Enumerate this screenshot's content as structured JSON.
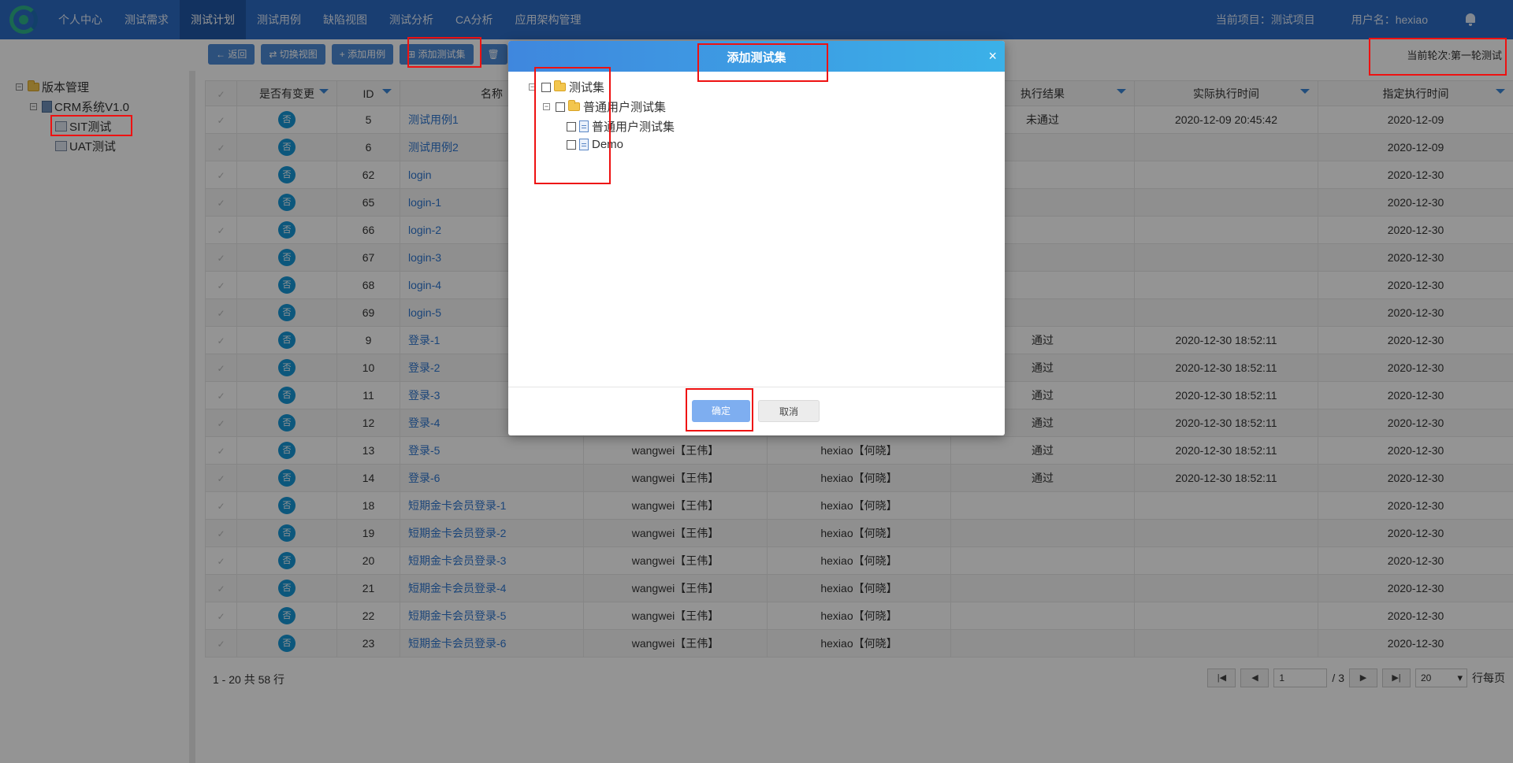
{
  "nav": {
    "items": [
      "个人中心",
      "测试需求",
      "测试计划",
      "测试用例",
      "缺陷视图",
      "测试分析",
      "CA分析",
      "应用架构管理"
    ],
    "active_index": 2,
    "project_label": "当前项目：测试项目",
    "user_label": "用户名：hexiao"
  },
  "toolbar": {
    "back": "返回",
    "switch_view": "切换视图",
    "add_case": "添加用例",
    "add_suite": "添加测试集"
  },
  "round_label": "当前轮次:第一轮测试",
  "tree": {
    "root": "版本管理",
    "project": "CRM系统V1.0",
    "children": [
      "SIT测试",
      "UAT测试"
    ]
  },
  "table": {
    "headers": {
      "changed": "是否有变更",
      "id": "ID",
      "name": "名称",
      "result": "执行结果",
      "actual_time": "实际执行时间",
      "planned_time": "指定执行时间"
    },
    "rows": [
      {
        "changed": "否",
        "id": "5",
        "name": "测试用例1",
        "creator": "",
        "executor": "",
        "result": "未通过",
        "actual": "2020-12-09 20:45:42",
        "planned": "2020-12-09"
      },
      {
        "changed": "否",
        "id": "6",
        "name": "测试用例2",
        "creator": "",
        "executor": "",
        "result": "",
        "actual": "",
        "planned": "2020-12-09"
      },
      {
        "changed": "否",
        "id": "62",
        "name": "login",
        "creator": "",
        "executor": "",
        "result": "",
        "actual": "",
        "planned": "2020-12-30"
      },
      {
        "changed": "否",
        "id": "65",
        "name": "login-1",
        "creator": "",
        "executor": "",
        "result": "",
        "actual": "",
        "planned": "2020-12-30"
      },
      {
        "changed": "否",
        "id": "66",
        "name": "login-2",
        "creator": "",
        "executor": "",
        "result": "",
        "actual": "",
        "planned": "2020-12-30"
      },
      {
        "changed": "否",
        "id": "67",
        "name": "login-3",
        "creator": "",
        "executor": "",
        "result": "",
        "actual": "",
        "planned": "2020-12-30"
      },
      {
        "changed": "否",
        "id": "68",
        "name": "login-4",
        "creator": "",
        "executor": "",
        "result": "",
        "actual": "",
        "planned": "2020-12-30"
      },
      {
        "changed": "否",
        "id": "69",
        "name": "login-5",
        "creator": "",
        "executor": "",
        "result": "",
        "actual": "",
        "planned": "2020-12-30"
      },
      {
        "changed": "否",
        "id": "9",
        "name": "登录-1",
        "creator": "",
        "executor": "",
        "result": "通过",
        "actual": "2020-12-30 18:52:11",
        "planned": "2020-12-30"
      },
      {
        "changed": "否",
        "id": "10",
        "name": "登录-2",
        "creator": "",
        "executor": "",
        "result": "通过",
        "actual": "2020-12-30 18:52:11",
        "planned": "2020-12-30"
      },
      {
        "changed": "否",
        "id": "11",
        "name": "登录-3",
        "creator": "",
        "executor": "",
        "result": "通过",
        "actual": "2020-12-30 18:52:11",
        "planned": "2020-12-30"
      },
      {
        "changed": "否",
        "id": "12",
        "name": "登录-4",
        "creator": "",
        "executor": "",
        "result": "通过",
        "actual": "2020-12-30 18:52:11",
        "planned": "2020-12-30"
      },
      {
        "changed": "否",
        "id": "13",
        "name": "登录-5",
        "creator": "wangwei【王伟】",
        "executor": "hexiao【何晓】",
        "result": "通过",
        "actual": "2020-12-30 18:52:11",
        "planned": "2020-12-30"
      },
      {
        "changed": "否",
        "id": "14",
        "name": "登录-6",
        "creator": "wangwei【王伟】",
        "executor": "hexiao【何晓】",
        "result": "通过",
        "actual": "2020-12-30 18:52:11",
        "planned": "2020-12-30"
      },
      {
        "changed": "否",
        "id": "18",
        "name": "短期金卡会员登录-1",
        "creator": "wangwei【王伟】",
        "executor": "hexiao【何晓】",
        "result": "",
        "actual": "",
        "planned": "2020-12-30"
      },
      {
        "changed": "否",
        "id": "19",
        "name": "短期金卡会员登录-2",
        "creator": "wangwei【王伟】",
        "executor": "hexiao【何晓】",
        "result": "",
        "actual": "",
        "planned": "2020-12-30"
      },
      {
        "changed": "否",
        "id": "20",
        "name": "短期金卡会员登录-3",
        "creator": "wangwei【王伟】",
        "executor": "hexiao【何晓】",
        "result": "",
        "actual": "",
        "planned": "2020-12-30"
      },
      {
        "changed": "否",
        "id": "21",
        "name": "短期金卡会员登录-4",
        "creator": "wangwei【王伟】",
        "executor": "hexiao【何晓】",
        "result": "",
        "actual": "",
        "planned": "2020-12-30"
      },
      {
        "changed": "否",
        "id": "22",
        "name": "短期金卡会员登录-5",
        "creator": "wangwei【王伟】",
        "executor": "hexiao【何晓】",
        "result": "",
        "actual": "",
        "planned": "2020-12-30"
      },
      {
        "changed": "否",
        "id": "23",
        "name": "短期金卡会员登录-6",
        "creator": "wangwei【王伟】",
        "executor": "hexiao【何晓】",
        "result": "",
        "actual": "",
        "planned": "2020-12-30"
      }
    ]
  },
  "footer": {
    "row_info": "1 - 20 共 58 行",
    "page_value": "1",
    "page_total": "/ 3",
    "page_size": "20",
    "per_page_label": "行每页"
  },
  "modal": {
    "title": "添加测试集",
    "close": "×",
    "tree_root": "测试集",
    "tree_group": "普通用户测试集",
    "tree_leaves": [
      "普通用户测试集",
      "Demo"
    ],
    "ok": "确定",
    "cancel": "取消"
  },
  "colors": {
    "nav_bg": "#2c6cc4",
    "modal_header": "#3f87de",
    "badge": "#1596d6",
    "link": "#2f77d1",
    "highlight": "#ee1111",
    "ok_button": "#7eaef0"
  }
}
